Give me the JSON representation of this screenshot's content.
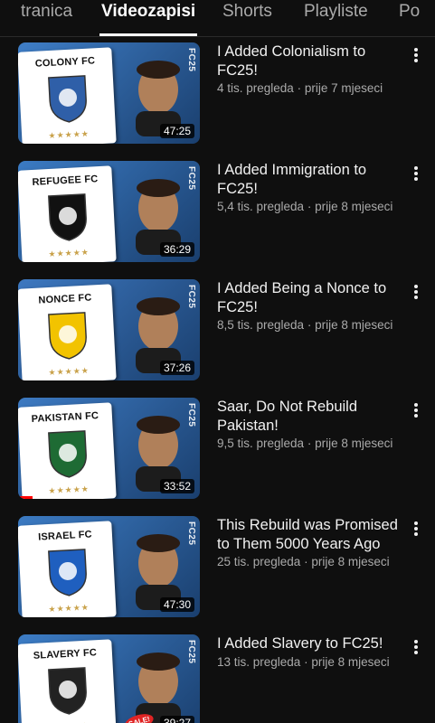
{
  "tabs": [
    {
      "label": "tranica",
      "active": false
    },
    {
      "label": "Videozapisi",
      "active": true
    },
    {
      "label": "Shorts",
      "active": false
    },
    {
      "label": "Playliste",
      "active": false
    },
    {
      "label": "Po",
      "active": false
    }
  ],
  "videos": [
    {
      "title": "I Added Colonialism to FC25!",
      "views": "4 tis. pregleda",
      "age": "prije 7 mjeseci",
      "duration": "47:25",
      "card_title": "COLONY FC",
      "stars": "★★★★★",
      "logo": "FC25",
      "crest_color": "#2f5fa8",
      "bg": "#3f7ec7",
      "watched": 0
    },
    {
      "title": "I Added Immigration to FC25!",
      "views": "5,4 tis. pregleda",
      "age": "prije 8 mjeseci",
      "duration": "36:29",
      "card_title": "REFUGEE FC",
      "stars": "★★★★★",
      "logo": "FC25",
      "crest_color": "#111111",
      "bg": "#3b7bc4",
      "watched": 0
    },
    {
      "title": "I Added Being a Nonce to FC25!",
      "views": "8,5 tis. pregleda",
      "age": "prije 8 mjeseci",
      "duration": "37:26",
      "card_title": "NONCE FC",
      "stars": "★★★★★",
      "logo": "FC25",
      "crest_color": "#f2c300",
      "bg": "#3d78c0",
      "watched": 0
    },
    {
      "title": "Saar, Do Not Rebuild Pakistan!",
      "views": "9,5 tis. pregleda",
      "age": "prije 8 mjeseci",
      "duration": "33:52",
      "card_title": "PAKISTAN FC",
      "stars": "★★★★★",
      "logo": "FC25",
      "crest_color": "#1e6b34",
      "bg": "#3d7ac2",
      "watched": 0.08
    },
    {
      "title": "This Rebuild was Promised to Them 5000 Years Ago",
      "views": "25 tis. pregleda",
      "age": "prije 8 mjeseci",
      "duration": "47:30",
      "card_title": "ISRAEL FC",
      "stars": "★★★★★",
      "logo": "FC25",
      "crest_color": "#1f5fbf",
      "bg": "#3c7bc3",
      "watched": 0
    },
    {
      "title": "I Added  Slavery to FC25!",
      "views": "13 tis. pregleda",
      "age": "prije 8 mjeseci",
      "duration": "39:27",
      "card_title": "SLAVERY FC",
      "stars": "★★★★★",
      "logo": "FC25",
      "crest_color": "#222222",
      "bg": "#3d7dc6",
      "watched": 0,
      "badge": "SALE!"
    }
  ],
  "separator": " · "
}
